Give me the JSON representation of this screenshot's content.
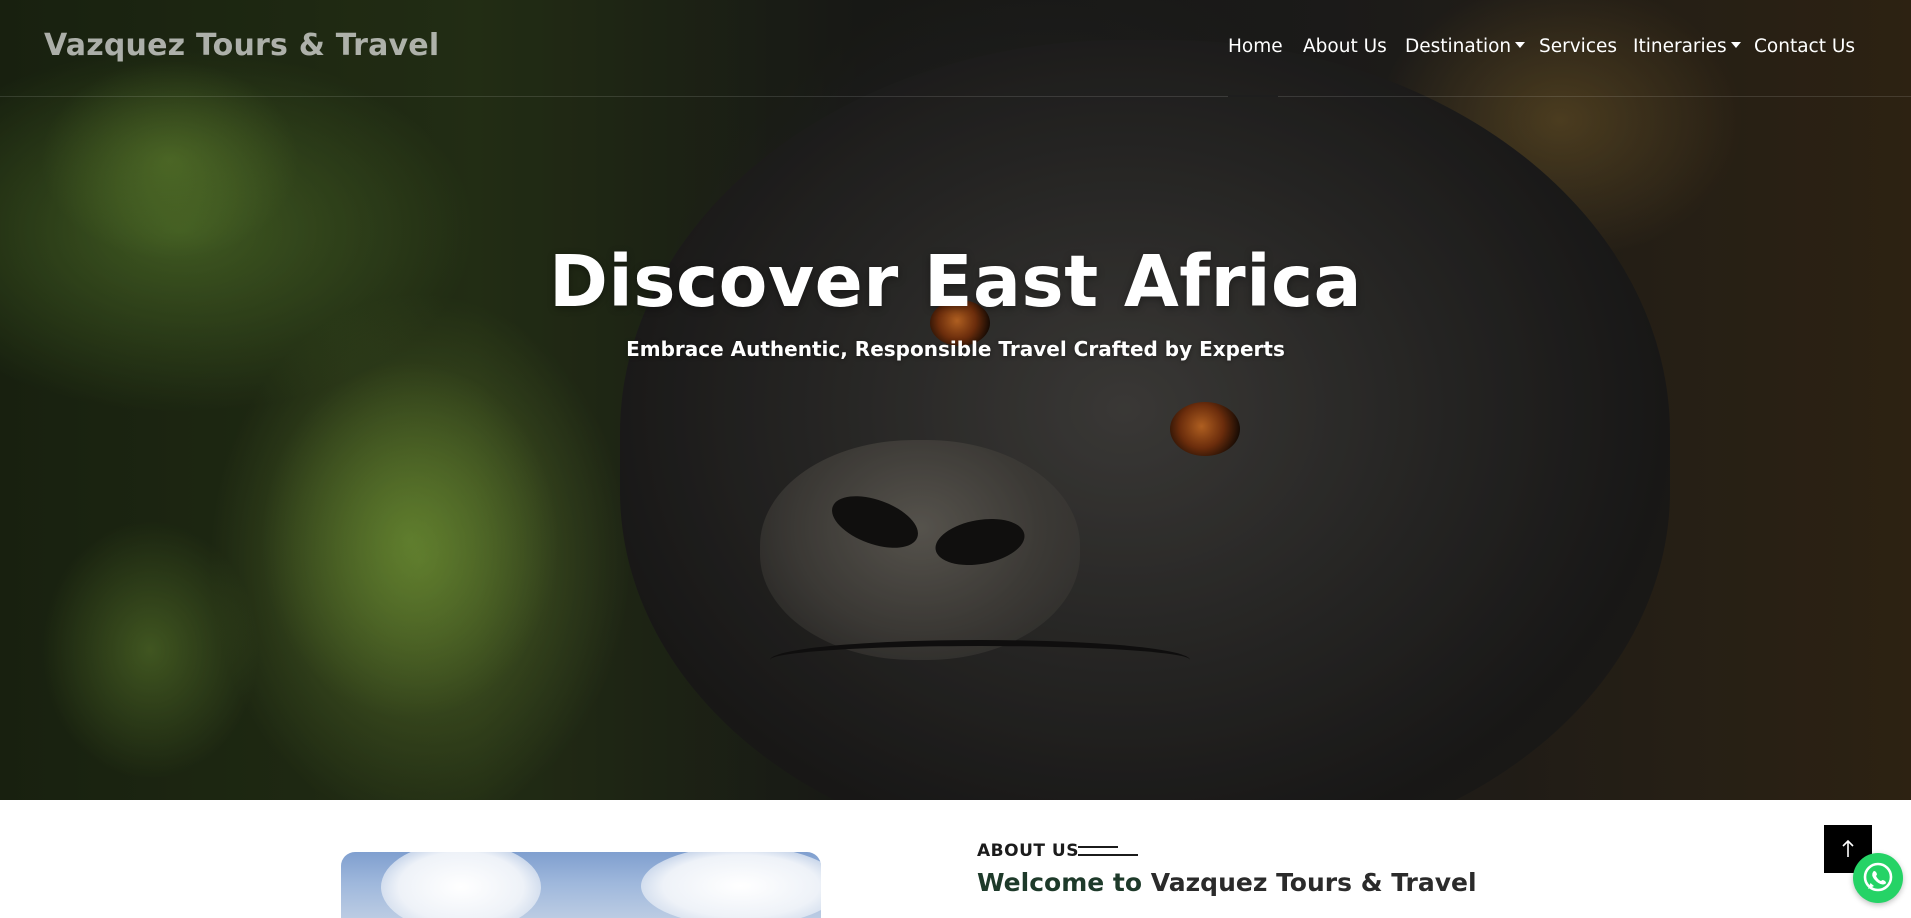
{
  "brand": {
    "name": "Vazquez Tours & Travel"
  },
  "nav": {
    "items": [
      {
        "label": "Home",
        "active": true,
        "has_dropdown": false
      },
      {
        "label": "About Us",
        "active": false,
        "has_dropdown": false
      },
      {
        "label": "Destination",
        "active": false,
        "has_dropdown": true
      },
      {
        "label": "Services",
        "active": false,
        "has_dropdown": false
      },
      {
        "label": "Itineraries",
        "active": false,
        "has_dropdown": true
      },
      {
        "label": "Contact Us",
        "active": false,
        "has_dropdown": false
      }
    ]
  },
  "hero": {
    "title": "Discover East Africa",
    "subtitle": "Embrace Authentic, Responsible Travel Crafted by Experts"
  },
  "about": {
    "label": "ABOUT US",
    "title_prefix": "Welcome to",
    "title_name": "Vazquez Tours & Travel"
  },
  "floating": {
    "back_to_top_icon": "arrow-up-icon",
    "whatsapp_icon": "whatsapp-icon"
  },
  "colors": {
    "whatsapp_green": "#25d366",
    "active_underline": "#1e1e1e",
    "title_accent": "#1e3a2a"
  }
}
